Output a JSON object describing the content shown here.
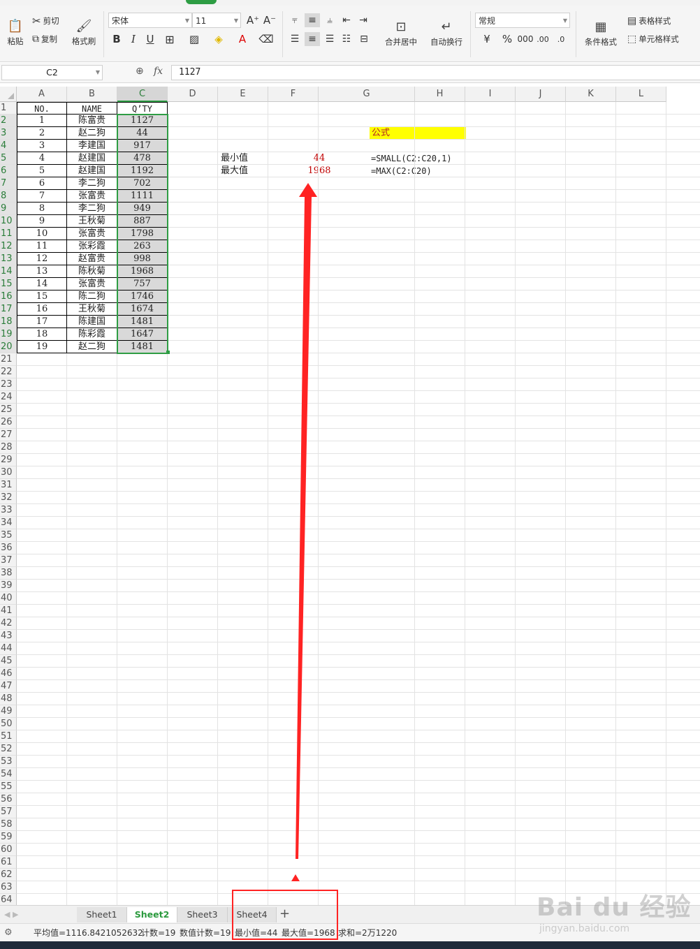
{
  "ribbon": {
    "paste": "粘贴",
    "cut": "剪切",
    "copy": "复制",
    "format_painter": "格式刷",
    "font_name": "宋体",
    "font_size": "11",
    "merge_center": "合并居中",
    "auto_wrap": "自动换行",
    "number_format": "常规",
    "conditional_format": "条件格式",
    "table_style": "表格样式",
    "cell_style": "单元格样式",
    "bold": "B",
    "italic": "I",
    "underline": "U"
  },
  "formula_bar": {
    "name_box": "C2",
    "fx": "fx",
    "value": "1127"
  },
  "columns": [
    "A",
    "B",
    "C",
    "D",
    "E",
    "F",
    "G",
    "H",
    "I",
    "J",
    "K",
    "L"
  ],
  "table": {
    "headers": [
      "NO.",
      "NAME",
      "Q’TY"
    ],
    "rows": [
      [
        "1",
        "陈富贵",
        "1127"
      ],
      [
        "2",
        "赵二狗",
        "44"
      ],
      [
        "3",
        "李建国",
        "917"
      ],
      [
        "4",
        "赵建国",
        "478"
      ],
      [
        "5",
        "赵建国",
        "1192"
      ],
      [
        "6",
        "李二狗",
        "702"
      ],
      [
        "7",
        "张富贵",
        "1111"
      ],
      [
        "8",
        "李二狗",
        "949"
      ],
      [
        "9",
        "王秋菊",
        "887"
      ],
      [
        "10",
        "张富贵",
        "1798"
      ],
      [
        "11",
        "张彩霞",
        "263"
      ],
      [
        "12",
        "赵富贵",
        "998"
      ],
      [
        "13",
        "陈秋菊",
        "1968"
      ],
      [
        "14",
        "张富贵",
        "757"
      ],
      [
        "15",
        "陈二狗",
        "1746"
      ],
      [
        "16",
        "王秋菊",
        "1674"
      ],
      [
        "17",
        "陈建国",
        "1481"
      ],
      [
        "18",
        "陈彩霞",
        "1647"
      ],
      [
        "19",
        "赵二狗",
        "1481"
      ]
    ]
  },
  "side": {
    "formula_title": "公式",
    "min_label": "最小值",
    "min_value": "44",
    "min_formula": "=SMALL(C2:C20,1)",
    "max_label": "最大值",
    "max_value": "1968",
    "max_formula": "=MAX(C2:C20)"
  },
  "sheets": [
    "Sheet1",
    "Sheet2",
    "Sheet3",
    "Sheet4"
  ],
  "active_sheet": "Sheet2",
  "status": {
    "average": "平均值=1116.8421052632",
    "count": "计数=19",
    "numeric_count": "数值计数=19",
    "min": "最小值=44",
    "max": "最大值=1968",
    "sum": "求和=2万1220"
  },
  "watermark": {
    "brand": "Bai du 经验",
    "url": "jingyan.baidu.com"
  },
  "colors": {
    "selection": "#2e9d44",
    "annotation_red": "#ff2323",
    "highlight_yellow": "#ffff00",
    "value_red": "#c00000"
  }
}
